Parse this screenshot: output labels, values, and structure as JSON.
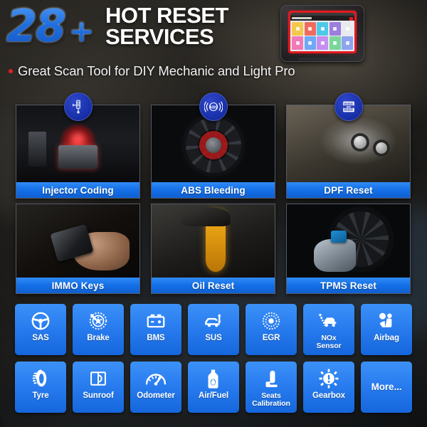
{
  "header": {
    "number": "28",
    "plus": "+",
    "title_line1": "HOT RESET",
    "title_line2": "SERVICES",
    "tagline": "Great Scan Tool for DIY Mechanic and Light Pro",
    "number_color": "#2477e6",
    "accent_color": "#1570e8",
    "bullet_color": "#e02020",
    "tablet": {
      "device_frame_color": "#e01b22",
      "app_tile_colors": [
        "#f5c84b",
        "#ef6b5e",
        "#4ec8e8",
        "#9b7ede",
        "#f07ab8",
        "#6fa8f5",
        "#c58ef0",
        "#7ad69a",
        "#8fa4f0",
        "#f0a05a"
      ]
    }
  },
  "cards": [
    {
      "label": "Injector Coding",
      "badge_icon": "injector-icon",
      "photo": "ph-injector"
    },
    {
      "label": "ABS Bleeding",
      "badge_icon": "abs-icon",
      "photo": "ph-abs"
    },
    {
      "label": "DPF Reset",
      "badge_icon": "dpf-icon",
      "photo": "ph-dpf"
    },
    {
      "label": "IMMO Keys",
      "badge_icon": "",
      "photo": "ph-immo"
    },
    {
      "label": "Oil Reset",
      "badge_icon": "",
      "photo": "ph-oil"
    },
    {
      "label": "TPMS Reset",
      "badge_icon": "",
      "photo": "ph-tpms"
    }
  ],
  "tiles": [
    {
      "label": "SAS",
      "icon": "steering-wheel-icon"
    },
    {
      "label": "Brake",
      "icon": "brake-disc-icon"
    },
    {
      "label": "BMS",
      "icon": "battery-icon"
    },
    {
      "label": "SUS",
      "icon": "suspension-car-icon"
    },
    {
      "label": "EGR",
      "icon": "egr-valve-icon"
    },
    {
      "label": "NOx\nSensor",
      "icon": "nox-sensor-icon"
    },
    {
      "label": "Airbag",
      "icon": "airbag-icon"
    },
    {
      "label": "Tyre",
      "icon": "tyre-icon"
    },
    {
      "label": "Sunroof",
      "icon": "sunroof-icon"
    },
    {
      "label": "Odometer",
      "icon": "odometer-icon"
    },
    {
      "label": "Air/Fuel",
      "icon": "fuel-bottle-icon"
    },
    {
      "label": "Seats\nCalibration",
      "icon": "car-seat-icon"
    },
    {
      "label": "Gearbox",
      "icon": "gear-warning-icon"
    },
    {
      "label": "More...",
      "icon": ""
    }
  ]
}
